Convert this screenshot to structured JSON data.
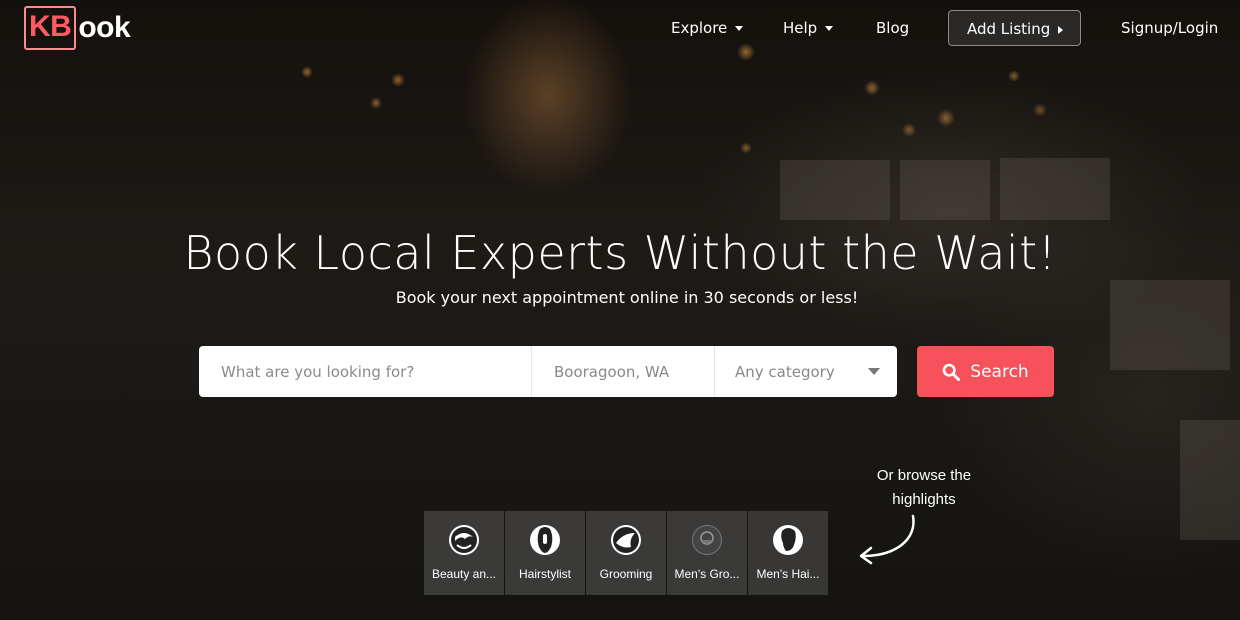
{
  "brand": {
    "logo_mark": "KB",
    "logo_rest": "ook"
  },
  "nav": {
    "explore": "Explore",
    "help": "Help",
    "blog": "Blog",
    "add_listing": "Add Listing",
    "signup_login": "Signup/Login"
  },
  "hero": {
    "title": "Book Local Experts Without the Wait!",
    "subtitle": "Book your next appointment online in 30 seconds or less!"
  },
  "search": {
    "what_placeholder": "What are you looking for?",
    "location_value": "Booragoon, WA",
    "category_value": "Any category",
    "button_label": "Search"
  },
  "browse": {
    "line1": "Or browse the",
    "line2": "highlights"
  },
  "categories": [
    {
      "label": "Beauty an...",
      "icon": "beauty-icon"
    },
    {
      "label": "Hairstylist",
      "icon": "hairstylist-icon"
    },
    {
      "label": "Grooming",
      "icon": "grooming-icon"
    },
    {
      "label": "Men's Gro...",
      "icon": "mens-grooming-icon"
    },
    {
      "label": "Men's Hai...",
      "icon": "mens-hair-icon"
    }
  ],
  "colors": {
    "accent": "#f7525b",
    "logo": "#ff5a61"
  }
}
